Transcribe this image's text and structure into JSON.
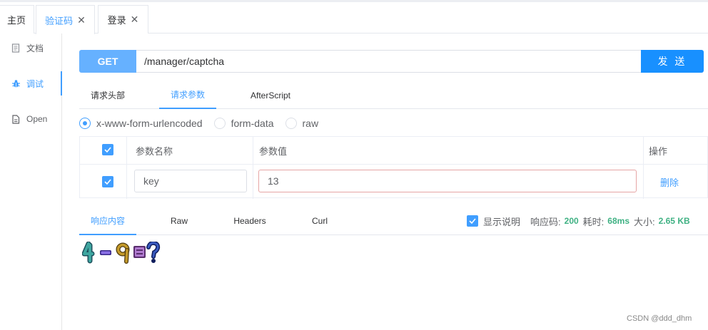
{
  "tabs": [
    {
      "label": "主页",
      "closable": false,
      "active": false
    },
    {
      "label": "验证码",
      "closable": true,
      "active": true
    },
    {
      "label": "登录",
      "closable": true,
      "active": false
    }
  ],
  "sidebar": {
    "items": [
      {
        "label": "文档",
        "icon": "document-icon",
        "active": false
      },
      {
        "label": "调试",
        "icon": "bug-icon",
        "active": true
      },
      {
        "label": "Open",
        "icon": "file-icon",
        "active": false
      }
    ]
  },
  "request": {
    "method": "GET",
    "url": "/manager/captcha",
    "send_label": "发 送"
  },
  "request_tabs": [
    {
      "label": "请求头部",
      "active": false
    },
    {
      "label": "请求参数",
      "active": true
    },
    {
      "label": "AfterScript",
      "active": false
    }
  ],
  "body_types": [
    {
      "label": "x-www-form-urlencoded",
      "checked": true
    },
    {
      "label": "form-data",
      "checked": false
    },
    {
      "label": "raw",
      "checked": false
    }
  ],
  "params_table": {
    "headers": {
      "name": "参数名称",
      "value": "参数值",
      "action": "操作"
    },
    "rows": [
      {
        "checked": true,
        "name": "key",
        "value": "13",
        "action": "删除"
      }
    ]
  },
  "response_tabs": [
    {
      "label": "响应内容",
      "active": true
    },
    {
      "label": "Raw",
      "active": false
    },
    {
      "label": "Headers",
      "active": false
    },
    {
      "label": "Curl",
      "active": false
    }
  ],
  "response_meta": {
    "show_desc_label": "显示说明",
    "show_desc_checked": true,
    "status_label": "响应码:",
    "status_value": "200",
    "time_label": "耗时:",
    "time_value": "68ms",
    "size_label": "大小:",
    "size_value": "2.65 KB"
  },
  "captcha": {
    "chars": [
      "4",
      "一",
      "9",
      "=",
      "?"
    ],
    "colors": [
      "#2f8f8a",
      "#6b4fc8",
      "#a8871e",
      "#8a4fa8",
      "#1f2f8a"
    ]
  },
  "watermark": "CSDN @ddd_dhm",
  "colors": {
    "accent": "#409eff",
    "method_bg": "#66b1ff",
    "send_bg": "#1890ff",
    "ok_green": "#3fb183"
  }
}
